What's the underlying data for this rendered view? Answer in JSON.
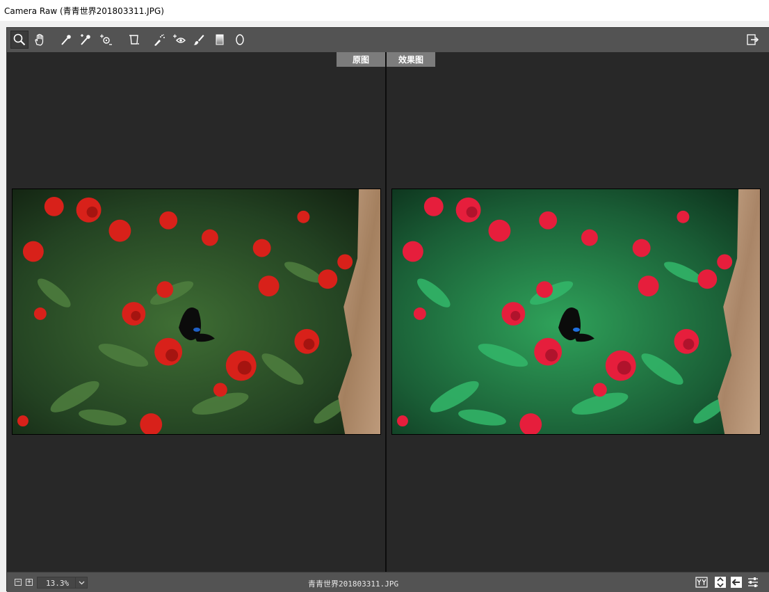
{
  "window": {
    "title": "Camera Raw (青青世界201803311.JPG)"
  },
  "toolbar": {
    "tools": [
      {
        "name": "zoom-tool",
        "icon": "magnifier-icon",
        "active": true
      },
      {
        "name": "hand-tool",
        "icon": "hand-icon"
      },
      {
        "name": "white-balance-tool",
        "icon": "eyedropper-icon"
      },
      {
        "name": "color-sampler-tool",
        "icon": "color-sampler-icon"
      },
      {
        "name": "targeted-adjustment-tool",
        "icon": "target-adjust-icon"
      },
      {
        "name": "transform-tool",
        "icon": "transform-icon"
      },
      {
        "name": "spot-removal-tool",
        "icon": "spot-removal-icon"
      },
      {
        "name": "red-eye-tool",
        "icon": "red-eye-icon"
      },
      {
        "name": "adjustment-brush-tool",
        "icon": "brush-icon"
      },
      {
        "name": "graduated-filter-tool",
        "icon": "graduated-filter-icon"
      },
      {
        "name": "radial-filter-tool",
        "icon": "radial-filter-icon"
      }
    ],
    "right_icon": "open-preferences-icon"
  },
  "preview": {
    "before_label": "原图",
    "after_label": "效果图",
    "subject": "red flowers with green leaves and a black butterfly"
  },
  "status": {
    "zoom": "13.3%",
    "filename": "青青世界201803311.JPG"
  },
  "colors": {
    "panel": "#535353",
    "canvas": "#282828",
    "label_bg": "#7c7c7c"
  }
}
